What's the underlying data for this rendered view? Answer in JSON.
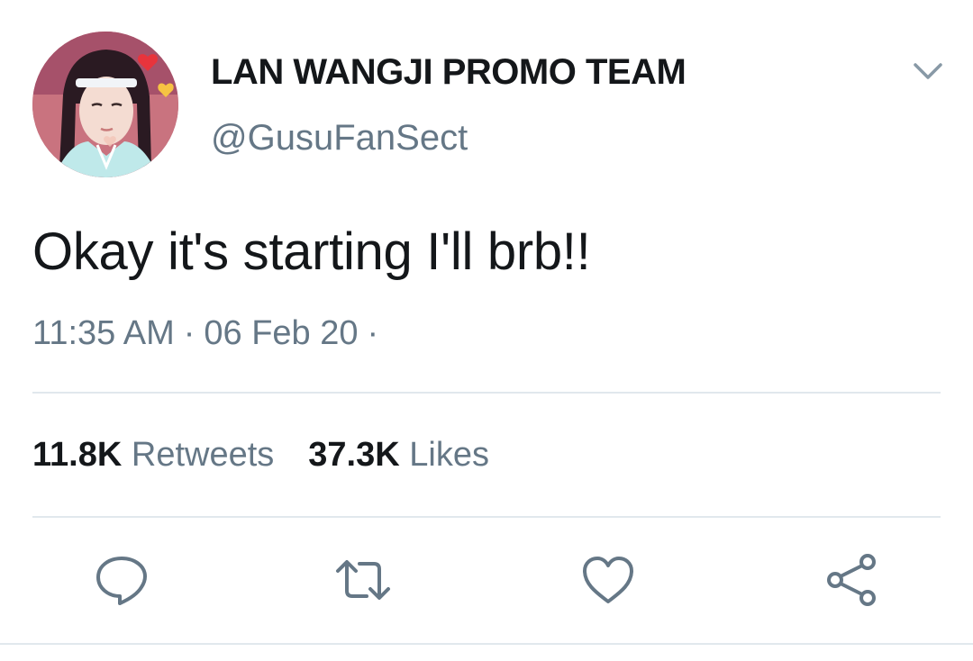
{
  "tweet": {
    "author": {
      "display_name": "LAN WANGJI PROMO TEAM",
      "handle": "@GusuFanSect",
      "avatar_icon": "profile-photo"
    },
    "text": "Okay it's starting I'll brb!!",
    "time": "11:35 AM",
    "date": "06 Feb 20",
    "separator": "·",
    "stats": {
      "retweets_count": "11.8K",
      "retweets_label": "Retweets",
      "likes_count": "37.3K",
      "likes_label": "Likes"
    },
    "actions": [
      {
        "name": "reply",
        "icon": "speech-bubble-icon"
      },
      {
        "name": "retweet",
        "icon": "retweet-arrows-icon"
      },
      {
        "name": "like",
        "icon": "heart-icon"
      },
      {
        "name": "share",
        "icon": "share-nodes-icon"
      }
    ]
  },
  "colors": {
    "primary_text": "#14171a",
    "secondary_text": "#657786",
    "divider": "#e1e8ed"
  }
}
